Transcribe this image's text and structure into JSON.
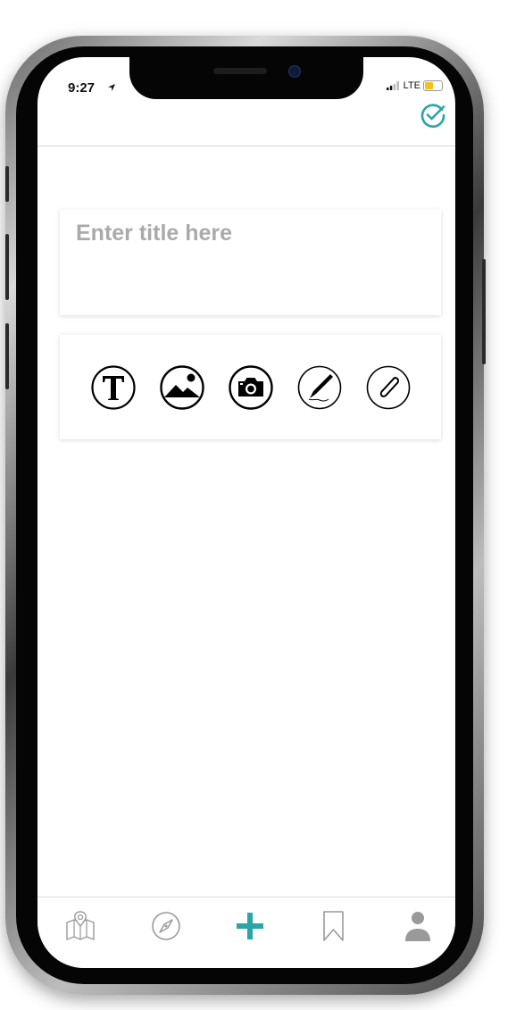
{
  "status_bar": {
    "time": "9:27",
    "network": "LTE"
  },
  "header": {
    "done_icon": "check-circle-icon"
  },
  "title_input": {
    "placeholder": "Enter title here",
    "value": ""
  },
  "tools": [
    {
      "name": "text-tool",
      "icon": "text-T-icon"
    },
    {
      "name": "image-tool",
      "icon": "image-mountain-icon"
    },
    {
      "name": "camera-tool",
      "icon": "camera-icon"
    },
    {
      "name": "drawing-tool",
      "icon": "pen-nib-icon"
    },
    {
      "name": "attachment-tool",
      "icon": "paperclip-icon"
    }
  ],
  "tab_bar": [
    {
      "name": "map",
      "icon": "map-icon",
      "active": false
    },
    {
      "name": "explore",
      "icon": "compass-icon",
      "active": false
    },
    {
      "name": "add",
      "icon": "plus-icon",
      "active": true
    },
    {
      "name": "bookmarks",
      "icon": "bookmark-icon",
      "active": false
    },
    {
      "name": "profile",
      "icon": "person-icon",
      "active": false
    }
  ],
  "colors": {
    "accent": "#2aa6a6",
    "placeholder": "#aaaaaa",
    "inactive_icon": "#9a9a9a"
  }
}
